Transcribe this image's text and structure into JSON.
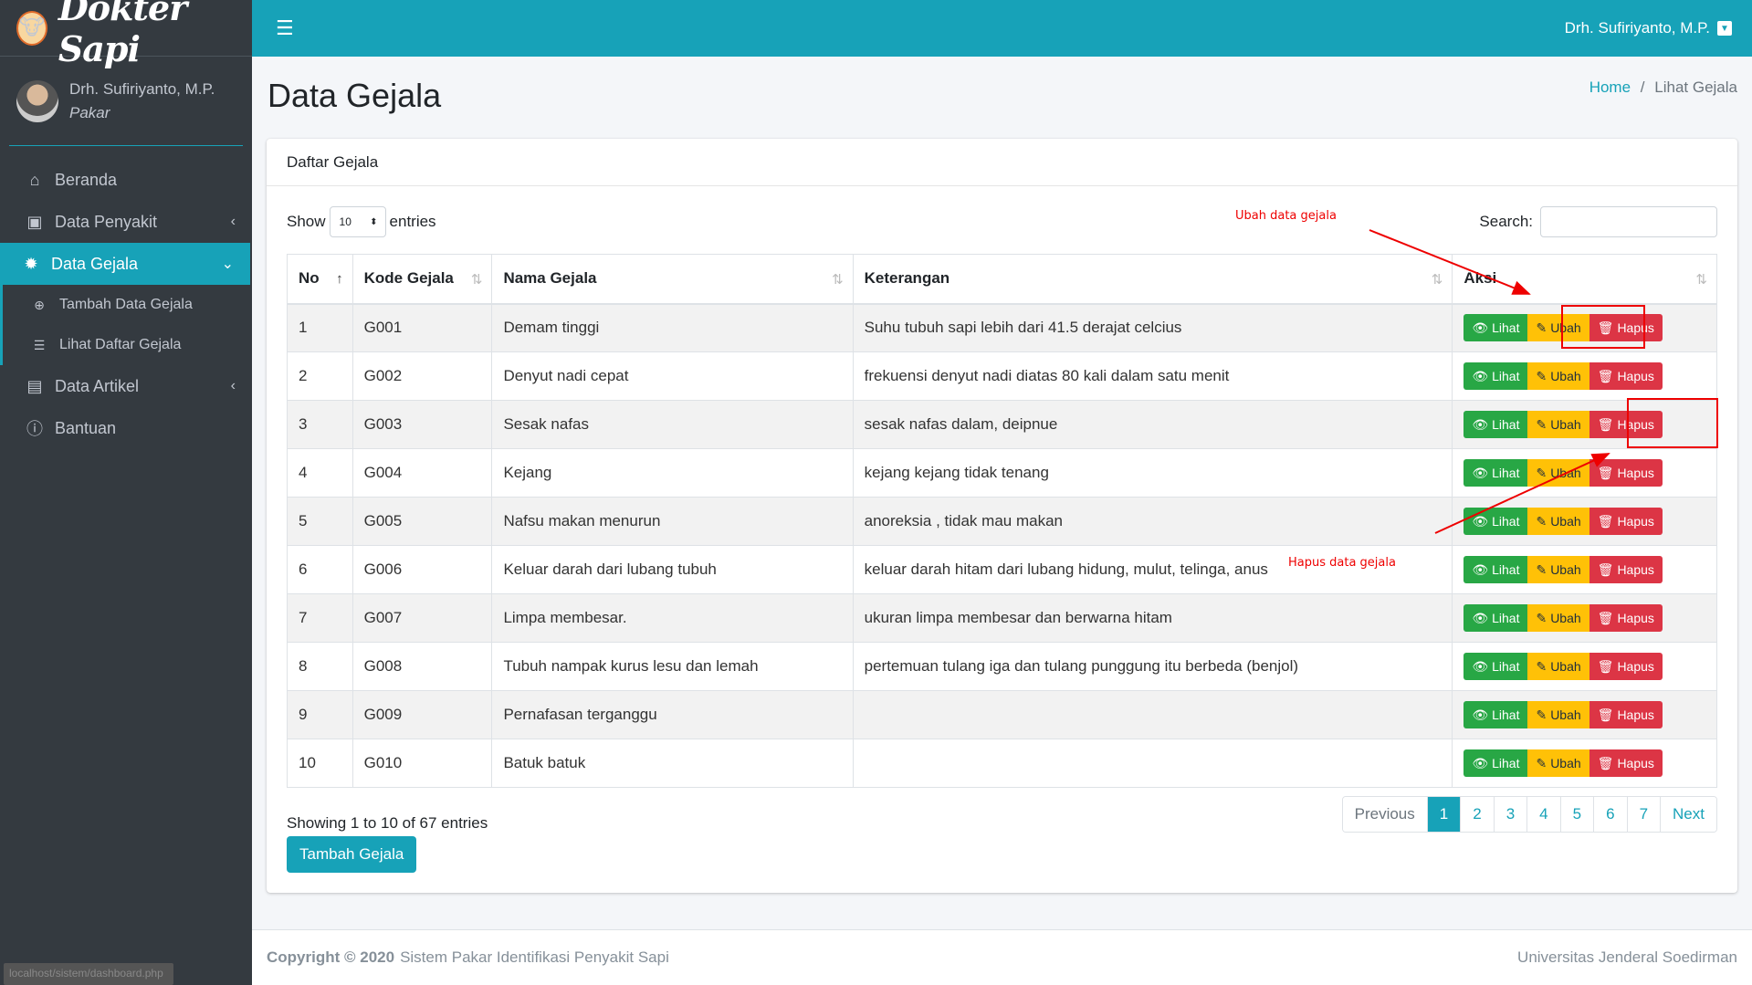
{
  "app": {
    "brand": "Dokter Sapi",
    "brand_icon": "cow-icon"
  },
  "user": {
    "name": "Drh. Sufiriyanto, M.P.",
    "role": "Pakar"
  },
  "sidebar": {
    "items": [
      {
        "label": "Beranda",
        "icon": "home-icon"
      },
      {
        "label": "Data Penyakit",
        "icon": "medical-icon"
      },
      {
        "label": "Data Gejala",
        "icon": "gear-icon"
      },
      {
        "label": "Data Artikel",
        "icon": "newspaper-icon"
      },
      {
        "label": "Bantuan",
        "icon": "info-icon"
      }
    ],
    "sub_items": [
      {
        "label": "Tambah Data Gejala",
        "icon": "plus-circle-icon"
      },
      {
        "label": "Lihat Daftar Gejala",
        "icon": "list-icon"
      }
    ]
  },
  "page": {
    "title": "Data Gejala",
    "breadcrumb_home": "Home",
    "breadcrumb_sep": "/",
    "breadcrumb_current": "Lihat Gejala"
  },
  "card": {
    "title": "Daftar Gejala"
  },
  "controls": {
    "show": "Show",
    "entries_value": "10",
    "entries": "entries",
    "search_label": "Search:"
  },
  "table": {
    "headers": [
      "No",
      "Kode Gejala",
      "Nama Gejala",
      "Keterangan",
      "Aksi"
    ],
    "rows": [
      {
        "no": "1",
        "kode": "G001",
        "nama": "Demam tinggi",
        "ket": "Suhu tubuh sapi lebih dari 41.5 derajat celcius"
      },
      {
        "no": "2",
        "kode": "G002",
        "nama": "Denyut nadi cepat",
        "ket": "frekuensi denyut nadi diatas 80 kali dalam satu menit"
      },
      {
        "no": "3",
        "kode": "G003",
        "nama": "Sesak nafas",
        "ket": "sesak nafas dalam, deipnue"
      },
      {
        "no": "4",
        "kode": "G004",
        "nama": "Kejang",
        "ket": "kejang kejang tidak tenang"
      },
      {
        "no": "5",
        "kode": "G005",
        "nama": "Nafsu makan menurun",
        "ket": "anoreksia , tidak mau makan"
      },
      {
        "no": "6",
        "kode": "G006",
        "nama": "Keluar darah dari lubang tubuh",
        "ket": "keluar darah hitam dari lubang hidung, mulut, telinga, anus"
      },
      {
        "no": "7",
        "kode": "G007",
        "nama": "Limpa membesar.",
        "ket": "ukuran limpa membesar dan berwarna hitam"
      },
      {
        "no": "8",
        "kode": "G008",
        "nama": "Tubuh nampak kurus lesu dan lemah",
        "ket": "pertemuan tulang iga dan tulang punggung itu berbeda (benjol)"
      },
      {
        "no": "9",
        "kode": "G009",
        "nama": "Pernafasan terganggu",
        "ket": ""
      },
      {
        "no": "10",
        "kode": "G010",
        "nama": "Batuk batuk",
        "ket": ""
      }
    ],
    "actions": {
      "view": "Lihat",
      "edit": "Ubah",
      "delete": "Hapus"
    }
  },
  "info": "Showing 1 to 10 of 67 entries",
  "pagination": [
    "Previous",
    "1",
    "2",
    "3",
    "4",
    "5",
    "6",
    "7",
    "Next"
  ],
  "add_button": "Tambah Gejala",
  "annotations": {
    "edit_note": "Ubah data gejala",
    "delete_note": "Hapus data gejala"
  },
  "footer": {
    "copyright": "Copyright © 2020",
    "system": "Sistem Pakar Identifikasi Penyakit Sapi",
    "university": "Universitas Jenderal Soedirman"
  },
  "status_url": "localhost/sistem/dashboard.php",
  "colors": {
    "primary": "#17a2b8",
    "sidebar": "#343a40",
    "success": "#28a745",
    "warning": "#ffc107",
    "danger": "#dc3545",
    "annotation": "#ee0000"
  }
}
